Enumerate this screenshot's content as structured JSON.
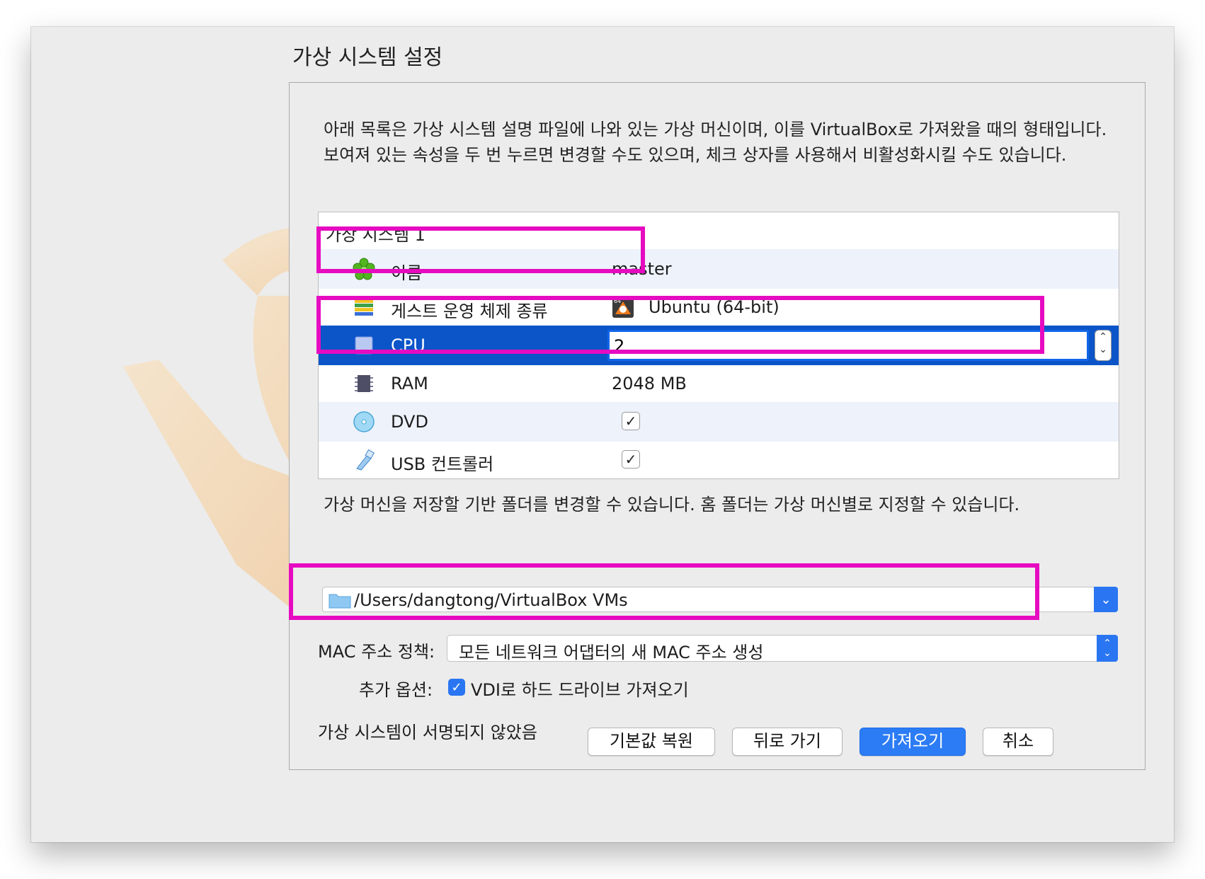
{
  "title": "가상 시스템 설정",
  "description": "아래 목록은 가상 시스템 설명 파일에 나와 있는 가상 머신이며, 이를 VirtualBox로 가져왔을 때의 형태입니다. 보여져 있는 속성을 두 번 누르면 변경할 수도 있으며, 체크 상자를 사용해서 비활성화시킬 수도 있습니다.",
  "vm": {
    "header": "가상 시스템 1",
    "rows": [
      {
        "label": "이름",
        "value": "master",
        "icon": "name-icon"
      },
      {
        "label": "게스트 운영 체제 종류",
        "value": "Ubuntu (64-bit)",
        "icon": "os-type-icon"
      },
      {
        "label": "CPU",
        "value": "2",
        "icon": "cpu-icon"
      },
      {
        "label": "RAM",
        "value": "2048 MB",
        "icon": "ram-icon"
      },
      {
        "label": "DVD",
        "checked": true,
        "icon": "dvd-icon"
      },
      {
        "label": "USB 컨트롤러",
        "checked": true,
        "icon": "usb-icon"
      }
    ]
  },
  "folder": {
    "description": "가상 머신을 저장할 기반 폴더를 변경할 수 있습니다. 홈 폴더는 가상 머신별로 지정할 수 있습니다.",
    "path": "/Users/dangtong/VirtualBox VMs"
  },
  "mac": {
    "label": "MAC 주소 정책:",
    "value": "모든 네트워크 어댑터의 새 MAC 주소 생성"
  },
  "extra": {
    "label": "추가 옵션:",
    "option": "VDI로 하드 드라이브 가져오기",
    "checked": true
  },
  "unsigned": "가상 시스템이 서명되지 않았음",
  "buttons": {
    "restore": "기본값 복원",
    "back": "뒤로 가기",
    "import": "가져오기",
    "cancel": "취소"
  },
  "colors": {
    "selection": "#0b55c9",
    "highlight": "#e60bc1",
    "accent": "#2c7cf5"
  }
}
